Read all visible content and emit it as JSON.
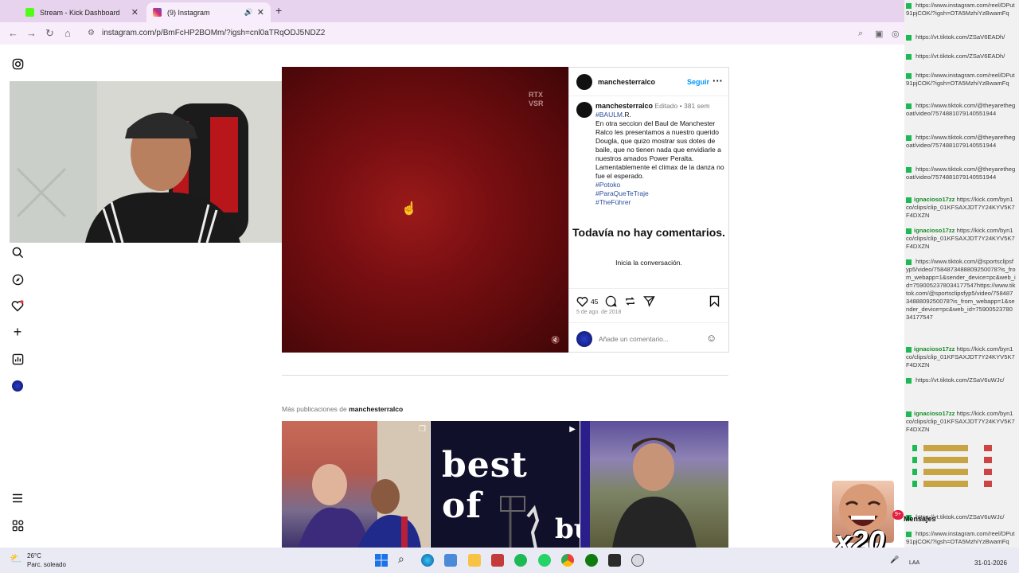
{
  "tabs": [
    {
      "title": "Stream - Kick Dashboard",
      "favicon_color": "#53fc18"
    },
    {
      "title": "(9) Instagram",
      "favicon_color": "#d62976"
    }
  ],
  "address_bar": {
    "url": "instagram.com/p/BmFcHP2BOMm/?igsh=cnl0aTRqODJ5NDZ2"
  },
  "post": {
    "author": "manchesterralco",
    "follow_label": "Seguir",
    "edited_label": "Editado",
    "separator": "•",
    "age": "381 sem",
    "hashtag_top": "#BAULM",
    "hashtag_top_suffix": ".R.",
    "caption": "En otra seccion del Baul de Manchester Ralco les presentamos a nuestro querido Dougla, que quizo mostrar sus dotes de baile, que no tienen nada que envidiarle a nuestros amados Power Peralta. Lamentablemente el climax de la danza no fue el esperado.",
    "hashtags": [
      "#Potoko",
      "#ParaQueTeTraje",
      "#TheFührer"
    ],
    "no_comments_title": "Todavía no hay comentarios.",
    "no_comments_sub": "Inicia la conversación.",
    "likes": "45",
    "date": "5 de ago. de 2018",
    "comment_placeholder": "Añade un comentario...",
    "media_watermark_1": "RTX",
    "media_watermark_2": "VSR"
  },
  "more_posts": {
    "prefix": "Más publicaciones de",
    "author": "manchesterralco",
    "thumb2_text": "best of",
    "thumb2_text2": "bu"
  },
  "taskbar": {
    "temperature": "26°C",
    "weather": "Parc. soleado",
    "time": "",
    "date": "31-01-2026",
    "lang": "LAA"
  },
  "overlay": {
    "messages_label": "Mensajes",
    "multiplier": "x20",
    "message_badge": "9+"
  },
  "chat": [
    {
      "user": "",
      "text": "https://www.instagram.com/reel/DPut91pjCOK/?igsh=OTA5MzhiYzBwamFq"
    },
    {
      "user": "",
      "text": "https://vt.tiktok.com/ZSaV6EADh/"
    },
    {
      "user": "",
      "text": "https://vt.tiktok.com/ZSaV6EADh/"
    },
    {
      "user": "",
      "text": "https://www.instagram.com/reel/DPut91pjCOK/?igsh=OTA5MzhiYzBwamFq"
    },
    {
      "user": "",
      "text": "https://www.tiktok.com/@theyaretheg oat/video/7574881079140551944"
    },
    {
      "user": "",
      "text": "https://www.tiktok.com/@theyaretheg oat/video/7574881079140551944"
    },
    {
      "user": "",
      "text": "https://www.tiktok.com/@theyaretheg oat/video/7574881079140551944"
    },
    {
      "user": "ignacioso17zz",
      "text": "https://kick.com/byn1co/clips/clip_01KFSAXJDT7Y24KYV5K7F4DXZN"
    },
    {
      "user": "ignacioso17zz",
      "text": "https://kick.com/byn1co/clips/clip_01KFSAXJDT7Y24KYV5K7F4DXZN"
    },
    {
      "user": "",
      "text": "https://www.tiktok.com/@sportsclipsfyp5/video/7584873488809250078?is_from_webapp=1&sender_device=pc&web_id=7590052378034177547https://www.tiktok.com/@sportsclipsfyp5/video/7584873488809250078?is_from_webapp=1&sender_device=pc&web_id=7590052378034177547"
    },
    {
      "user": "ignacioso17zz",
      "text": "https://kick.com/byn1co/clips/clip_01KFSAXJDT7Y24KYV5K7F4DXZN"
    },
    {
      "user": "",
      "text": "https://vt.tiktok.com/ZSaV6uWJc/"
    },
    {
      "user": "ignacioso17zz",
      "text": "https://kick.com/byn1co/clips/clip_01KFSAXJDT7Y24KYV5K7F4DXZN"
    },
    {
      "user": "",
      "text": "https://vt.tiktok.com/ZSaV6uWJc/"
    },
    {
      "user": "",
      "text": "https://www.instagram.com/reel/DPut91pjCOK/?igsh=OTA5MzhiYzBwamFq"
    }
  ],
  "colors": {
    "accent_blue": "#0095f6",
    "hashtag": "#2a4f9c",
    "kick_green": "#53fc18",
    "chat_user": "#1a8a2a"
  },
  "icons": [
    "instagram-icon",
    "search-icon",
    "explore-icon",
    "heart-icon",
    "create-icon",
    "stats-icon",
    "profile-icon",
    "menu-icon",
    "threads-icon"
  ]
}
